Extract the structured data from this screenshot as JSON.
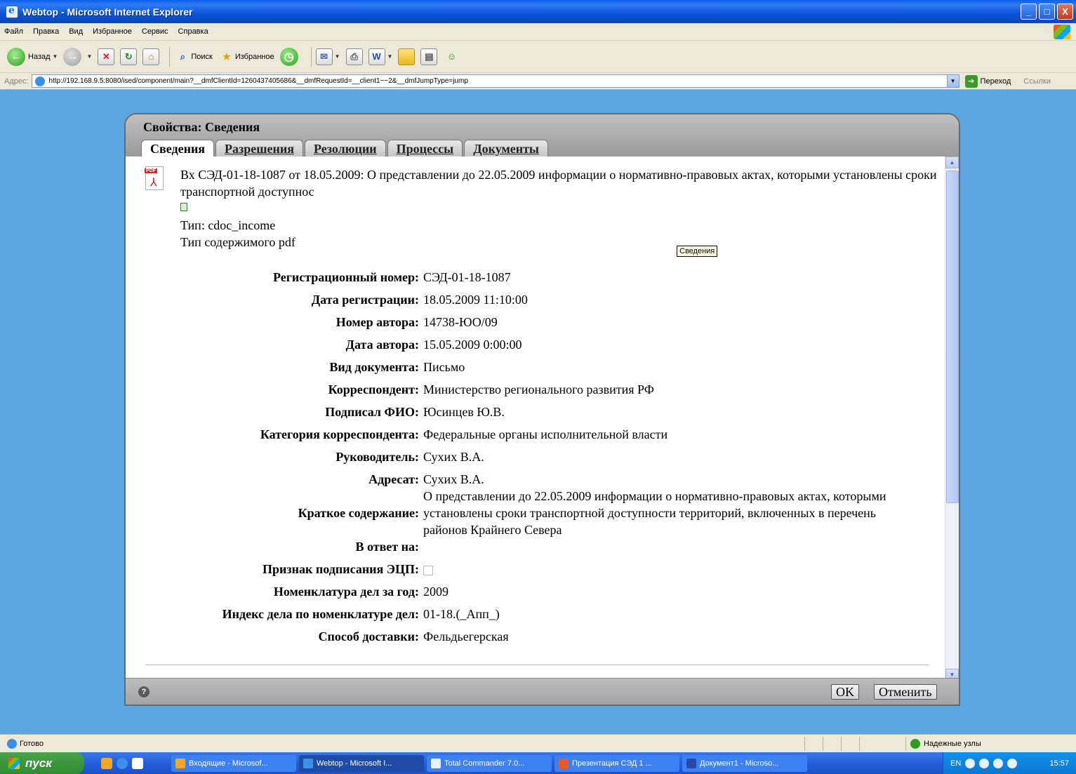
{
  "window": {
    "title": "Webtop - Microsoft Internet Explorer",
    "btn_min": "_",
    "btn_max": "□",
    "btn_close": "X"
  },
  "menu": [
    "Файл",
    "Правка",
    "Вид",
    "Избранное",
    "Сервис",
    "Справка"
  ],
  "toolbar": {
    "back_label": "Назад",
    "search_label": "Поиск",
    "favorites_label": "Избранное"
  },
  "address": {
    "label": "Адрес:",
    "url": "http://192.168.9.5:8080/ised/component/main?__dmfClientId=1260437405686&__dmfRequestId=__client1~~2&__dmfJumpType=jump",
    "go_label": "Переход",
    "links_label": "Ссылки"
  },
  "dialog": {
    "title": "Свойства: Сведения",
    "tabs": [
      "Сведения",
      "Разрешения",
      "Резолюции",
      "Процессы",
      "Документы"
    ],
    "doc_title": "Вх СЭД-01-18-1087 от 18.05.2009: О представлении до 22.05.2009 информации о нормативно-правовых актах, которыми установлены сроки транспортной доступнос",
    "type_line": "Тип: cdoc_income",
    "content_type_line": "Тип содержимого pdf",
    "tooltip": "Сведения",
    "properties": [
      {
        "label": "Регистрационный номер:",
        "value": "СЭД-01-18-1087"
      },
      {
        "label": "Дата регистрации:",
        "value": "18.05.2009 11:10:00"
      },
      {
        "label": "Номер автора:",
        "value": "14738-ЮО/09"
      },
      {
        "label": "Дата автора:",
        "value": "15.05.2009 0:00:00"
      },
      {
        "label": "Вид документа:",
        "value": "Письмо"
      },
      {
        "label": "Корреспондент:",
        "value": "Министерство регионального развития РФ"
      },
      {
        "label": "Подписал ФИО:",
        "value": "Юсинцев Ю.В."
      },
      {
        "label": "Категория корреспондента:",
        "value": "Федеральные органы исполнительной власти"
      },
      {
        "label": "Руководитель:",
        "value": "Сухих В.А."
      },
      {
        "label": "Адресат:",
        "value": "Сухих В.А."
      },
      {
        "label": "Краткое содержание:",
        "value": "О представлении до 22.05.2009 информации о нормативно-правовых актах, которыми установлены сроки транспортной доступности территорий, включенных в перечень районов Крайнего Севера"
      },
      {
        "label": "В ответ на:",
        "value": ""
      },
      {
        "label": "Признак подписания ЭЦП:",
        "value": ""
      },
      {
        "label": "Номенклатура дел за год:",
        "value": "2009"
      },
      {
        "label": "Индекс дела по номенклатуре дел:",
        "value": "01-18.(_Апп_)"
      },
      {
        "label": "Способ доставки:",
        "value": "Фельдьегерская"
      }
    ],
    "ok_label": "OK",
    "cancel_label": "Отменить",
    "help": "?"
  },
  "status": {
    "text": "Готово",
    "zone": "Надежные узлы"
  },
  "taskbar": {
    "start_label": "пуск",
    "tasks": [
      "Входящие - Microsof...",
      "Webtop - Microsoft I...",
      "Total Commander 7.0...",
      "Презентация СЭД 1 ...",
      "Документ1 - Microso..."
    ],
    "lang": "EN",
    "clock": "15:57"
  }
}
